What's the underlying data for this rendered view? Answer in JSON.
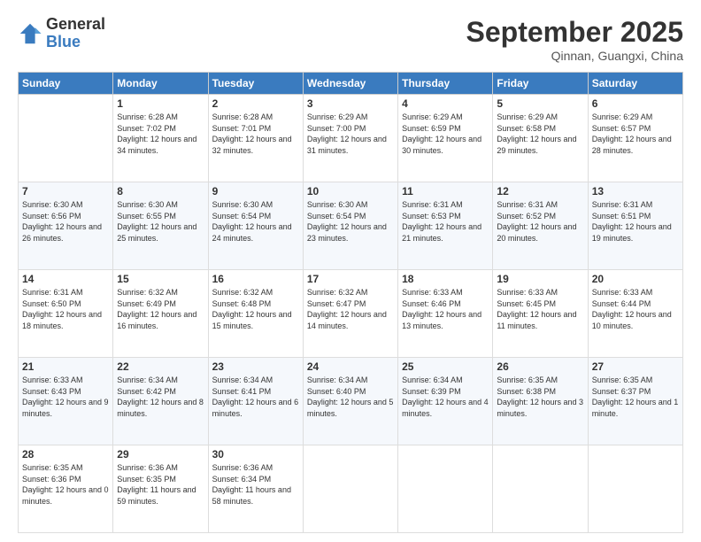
{
  "logo": {
    "general": "General",
    "blue": "Blue"
  },
  "header": {
    "month": "September 2025",
    "location": "Qinnan, Guangxi, China"
  },
  "weekdays": [
    "Sunday",
    "Monday",
    "Tuesday",
    "Wednesday",
    "Thursday",
    "Friday",
    "Saturday"
  ],
  "weeks": [
    [
      {
        "day": "",
        "sunrise": "",
        "sunset": "",
        "daylight": ""
      },
      {
        "day": "1",
        "sunrise": "6:28 AM",
        "sunset": "7:02 PM",
        "daylight": "12 hours and 34 minutes."
      },
      {
        "day": "2",
        "sunrise": "6:28 AM",
        "sunset": "7:01 PM",
        "daylight": "12 hours and 32 minutes."
      },
      {
        "day": "3",
        "sunrise": "6:29 AM",
        "sunset": "7:00 PM",
        "daylight": "12 hours and 31 minutes."
      },
      {
        "day": "4",
        "sunrise": "6:29 AM",
        "sunset": "6:59 PM",
        "daylight": "12 hours and 30 minutes."
      },
      {
        "day": "5",
        "sunrise": "6:29 AM",
        "sunset": "6:58 PM",
        "daylight": "12 hours and 29 minutes."
      },
      {
        "day": "6",
        "sunrise": "6:29 AM",
        "sunset": "6:57 PM",
        "daylight": "12 hours and 28 minutes."
      }
    ],
    [
      {
        "day": "7",
        "sunrise": "6:30 AM",
        "sunset": "6:56 PM",
        "daylight": "12 hours and 26 minutes."
      },
      {
        "day": "8",
        "sunrise": "6:30 AM",
        "sunset": "6:55 PM",
        "daylight": "12 hours and 25 minutes."
      },
      {
        "day": "9",
        "sunrise": "6:30 AM",
        "sunset": "6:54 PM",
        "daylight": "12 hours and 24 minutes."
      },
      {
        "day": "10",
        "sunrise": "6:30 AM",
        "sunset": "6:54 PM",
        "daylight": "12 hours and 23 minutes."
      },
      {
        "day": "11",
        "sunrise": "6:31 AM",
        "sunset": "6:53 PM",
        "daylight": "12 hours and 21 minutes."
      },
      {
        "day": "12",
        "sunrise": "6:31 AM",
        "sunset": "6:52 PM",
        "daylight": "12 hours and 20 minutes."
      },
      {
        "day": "13",
        "sunrise": "6:31 AM",
        "sunset": "6:51 PM",
        "daylight": "12 hours and 19 minutes."
      }
    ],
    [
      {
        "day": "14",
        "sunrise": "6:31 AM",
        "sunset": "6:50 PM",
        "daylight": "12 hours and 18 minutes."
      },
      {
        "day": "15",
        "sunrise": "6:32 AM",
        "sunset": "6:49 PM",
        "daylight": "12 hours and 16 minutes."
      },
      {
        "day": "16",
        "sunrise": "6:32 AM",
        "sunset": "6:48 PM",
        "daylight": "12 hours and 15 minutes."
      },
      {
        "day": "17",
        "sunrise": "6:32 AM",
        "sunset": "6:47 PM",
        "daylight": "12 hours and 14 minutes."
      },
      {
        "day": "18",
        "sunrise": "6:33 AM",
        "sunset": "6:46 PM",
        "daylight": "12 hours and 13 minutes."
      },
      {
        "day": "19",
        "sunrise": "6:33 AM",
        "sunset": "6:45 PM",
        "daylight": "12 hours and 11 minutes."
      },
      {
        "day": "20",
        "sunrise": "6:33 AM",
        "sunset": "6:44 PM",
        "daylight": "12 hours and 10 minutes."
      }
    ],
    [
      {
        "day": "21",
        "sunrise": "6:33 AM",
        "sunset": "6:43 PM",
        "daylight": "12 hours and 9 minutes."
      },
      {
        "day": "22",
        "sunrise": "6:34 AM",
        "sunset": "6:42 PM",
        "daylight": "12 hours and 8 minutes."
      },
      {
        "day": "23",
        "sunrise": "6:34 AM",
        "sunset": "6:41 PM",
        "daylight": "12 hours and 6 minutes."
      },
      {
        "day": "24",
        "sunrise": "6:34 AM",
        "sunset": "6:40 PM",
        "daylight": "12 hours and 5 minutes."
      },
      {
        "day": "25",
        "sunrise": "6:34 AM",
        "sunset": "6:39 PM",
        "daylight": "12 hours and 4 minutes."
      },
      {
        "day": "26",
        "sunrise": "6:35 AM",
        "sunset": "6:38 PM",
        "daylight": "12 hours and 3 minutes."
      },
      {
        "day": "27",
        "sunrise": "6:35 AM",
        "sunset": "6:37 PM",
        "daylight": "12 hours and 1 minute."
      }
    ],
    [
      {
        "day": "28",
        "sunrise": "6:35 AM",
        "sunset": "6:36 PM",
        "daylight": "12 hours and 0 minutes."
      },
      {
        "day": "29",
        "sunrise": "6:36 AM",
        "sunset": "6:35 PM",
        "daylight": "11 hours and 59 minutes."
      },
      {
        "day": "30",
        "sunrise": "6:36 AM",
        "sunset": "6:34 PM",
        "daylight": "11 hours and 58 minutes."
      },
      {
        "day": "",
        "sunrise": "",
        "sunset": "",
        "daylight": ""
      },
      {
        "day": "",
        "sunrise": "",
        "sunset": "",
        "daylight": ""
      },
      {
        "day": "",
        "sunrise": "",
        "sunset": "",
        "daylight": ""
      },
      {
        "day": "",
        "sunrise": "",
        "sunset": "",
        "daylight": ""
      }
    ]
  ]
}
